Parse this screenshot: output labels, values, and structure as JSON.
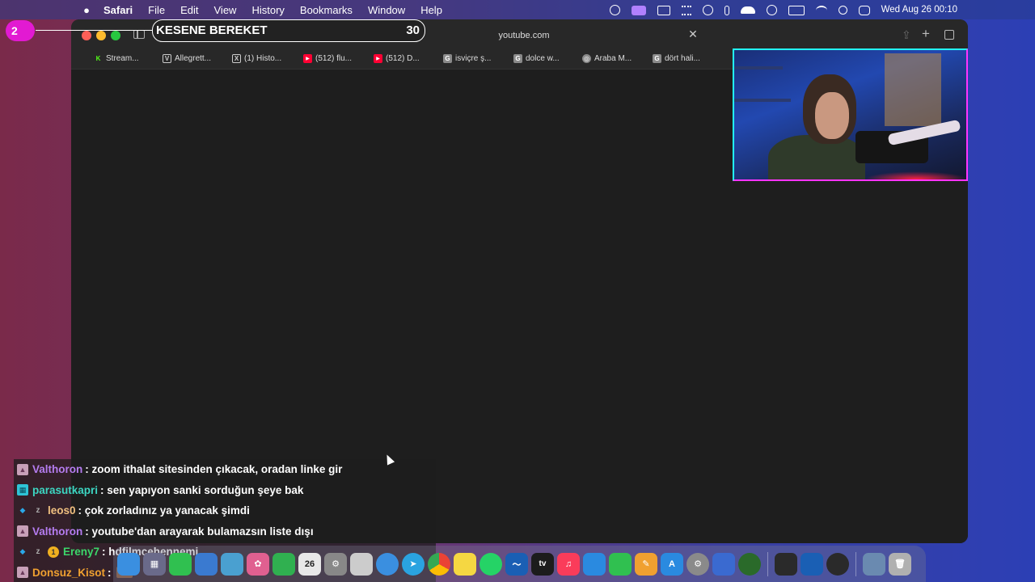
{
  "menubar": {
    "app_name": "Safari",
    "menus": [
      "File",
      "Edit",
      "View",
      "History",
      "Bookmarks",
      "Window",
      "Help"
    ],
    "clock": "Wed Aug 26  00:10"
  },
  "overlay": {
    "badge_number": "2",
    "title": "KESENE BEREKET",
    "count": "30"
  },
  "browser": {
    "address": "youtube.com",
    "bookmarks": [
      {
        "label": "Stream...",
        "icon": "K",
        "color": "#53fc18"
      },
      {
        "label": "Allegrett...",
        "icon": "V",
        "color": "#1a5fb4"
      },
      {
        "label": "(1) Histo...",
        "icon": "X",
        "color": "#000000"
      },
      {
        "label": "(512) flu...",
        "icon": "▶",
        "color": "#ff0033"
      },
      {
        "label": "(512) D...",
        "icon": "▶",
        "color": "#ff0033"
      },
      {
        "label": "isviçre ş...",
        "icon": "G",
        "color": "#8a8a8a"
      },
      {
        "label": "dolce w...",
        "icon": "G",
        "color": "#8a8a8a"
      },
      {
        "label": "Araba M...",
        "icon": "◎",
        "color": "#8a8a8a"
      },
      {
        "label": "dört hali...",
        "icon": "G",
        "color": "#8a8a8a"
      }
    ]
  },
  "chat": [
    {
      "user": "Valthoron",
      "color": "#b57cf0",
      "badge": "▲",
      "badge_color": "#c8a0b8",
      "message": ": zoom ithalat sitesinden çıkacak, oradan linke gir"
    },
    {
      "user": "parasutkapri",
      "color": "#3cd6c2",
      "badge": "▦",
      "badge_color": "#2ec4d6",
      "message": ": sen yapıyon sanki sorduğun şeye bak"
    },
    {
      "user": "leos0",
      "color": "#f0c080",
      "badge": "◆",
      "badge_color": "#2aa8e8",
      "message": ": çok zorladınız ya yanacak şimdi"
    },
    {
      "user": "Valthoron",
      "color": "#b57cf0",
      "badge": "▲",
      "badge_color": "#c8a0b8",
      "message": ": youtube'dan arayarak bulamazsın liste dışı"
    },
    {
      "user": "Ereny7",
      "color": "#3cd66a",
      "badge": "◆",
      "badge_color": "#2aa8e8",
      "message": ": hdfilmcehennemi"
    },
    {
      "user": "Donsuz_Kisot",
      "color": "#f0a030",
      "badge": "▲",
      "badge_color": "#c8a0b8",
      "message": ":"
    }
  ],
  "dock": {
    "calendar_day": "26",
    "tv_label": "tv",
    "apps": [
      {
        "name": "finder",
        "color": "#3a8fe0"
      },
      {
        "name": "launchpad",
        "color": "#6a6a8a"
      },
      {
        "name": "messages",
        "color": "#30c050"
      },
      {
        "name": "mail",
        "color": "#3a7ad0"
      },
      {
        "name": "maps",
        "color": "#4aa0d0"
      },
      {
        "name": "photos",
        "color": "#e06090"
      },
      {
        "name": "facetime",
        "color": "#30b050"
      },
      {
        "name": "calendar",
        "color": "#e8e8e8"
      },
      {
        "name": "settings",
        "color": "#888888"
      },
      {
        "name": "notes",
        "color": "#cccccc"
      },
      {
        "name": "safari",
        "color": "#3a8fe0"
      },
      {
        "name": "telegram",
        "color": "#2aa3e0"
      },
      {
        "name": "chrome",
        "color": "#e0e0e0"
      },
      {
        "name": "stickies",
        "color": "#f5d742"
      },
      {
        "name": "whatsapp",
        "color": "#25d366"
      },
      {
        "name": "freeform",
        "color": "#1a5fb4"
      },
      {
        "name": "apple-tv",
        "color": "#1c1c1c"
      },
      {
        "name": "music",
        "color": "#fa3c5a"
      },
      {
        "name": "keynote",
        "color": "#2a8ae0"
      },
      {
        "name": "numbers",
        "color": "#30c050"
      },
      {
        "name": "pages",
        "color": "#f0a030"
      },
      {
        "name": "app-store",
        "color": "#2a8ae0"
      },
      {
        "name": "system-settings",
        "color": "#8a8a8a"
      },
      {
        "name": "files",
        "color": "#3a6ad0"
      },
      {
        "name": "xbox",
        "color": "#2a6a2a"
      },
      {
        "name": "epic-games",
        "color": "#2a2a2a"
      },
      {
        "name": "wd-drive",
        "color": "#1a5fb4"
      },
      {
        "name": "clock",
        "color": "#2a2a2a"
      },
      {
        "name": "preview",
        "color": "#6a8ab0"
      },
      {
        "name": "trash",
        "color": "#b0b0b0"
      }
    ]
  }
}
